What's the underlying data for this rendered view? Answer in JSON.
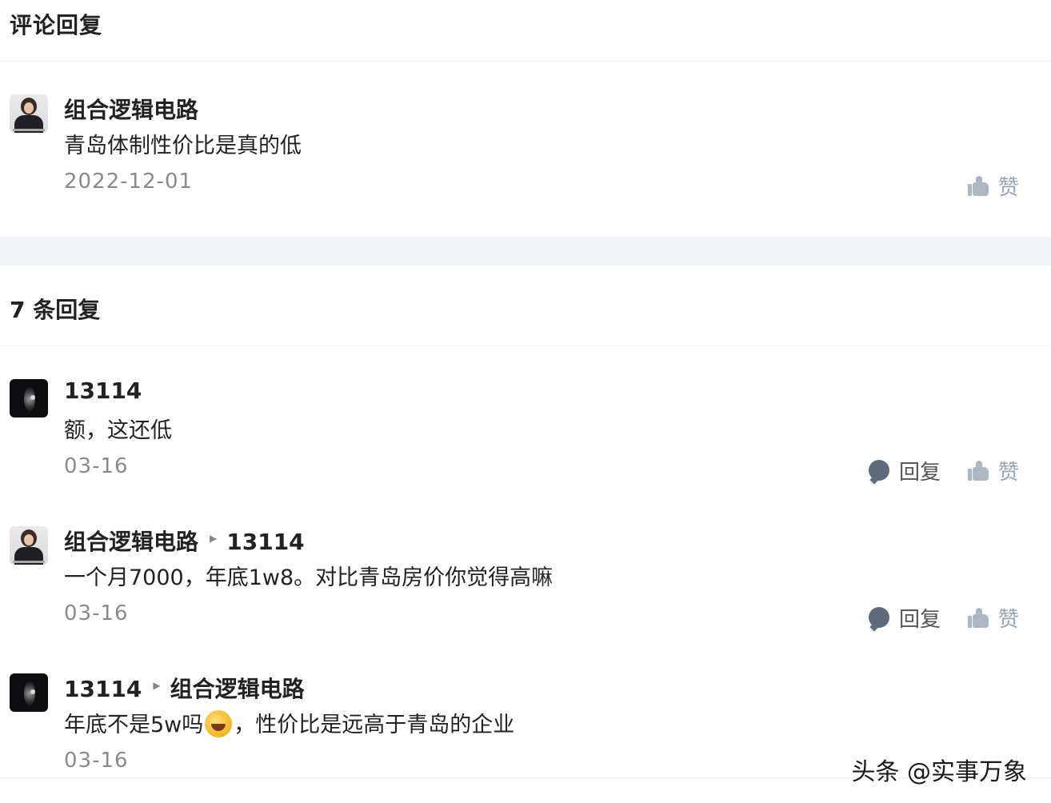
{
  "header": {
    "title": "评论回复"
  },
  "main_comment": {
    "username": "组合逻辑电路",
    "content": "青岛体制性价比是真的低",
    "date": "2022-12-01",
    "like_label": "赞"
  },
  "replies_section": {
    "title": "7 条回复"
  },
  "replies": [
    {
      "username": "13114",
      "content": "额，这还低",
      "date": "03-16",
      "reply_label": "回复",
      "like_label": "赞"
    },
    {
      "username": "组合逻辑电路",
      "reply_to": "13114",
      "content": "一个月7000，年底1w8。对比青岛房价你觉得高嘛",
      "date": "03-16",
      "reply_label": "回复",
      "like_label": "赞"
    },
    {
      "username": "13114",
      "reply_to": "组合逻辑电路",
      "content_before_emoji": "年底不是5w吗",
      "content_after_emoji": "，性价比是远高于青岛的企业",
      "date": "03-16"
    }
  ],
  "watermark": {
    "text": "头条 @实事万象"
  },
  "icons": {
    "reply": "comment-bubble-icon",
    "like": "thumbs-up-icon",
    "reply_arrow": "triangle-right-icon",
    "emoji": "laughing-crying-emoji"
  },
  "colors": {
    "text_primary": "#222222",
    "text_secondary": "#8a8a8a",
    "icon_reply": "#5f6b7c",
    "icon_like": "#aeb6c2",
    "divider_band": "#f4f5f7"
  }
}
